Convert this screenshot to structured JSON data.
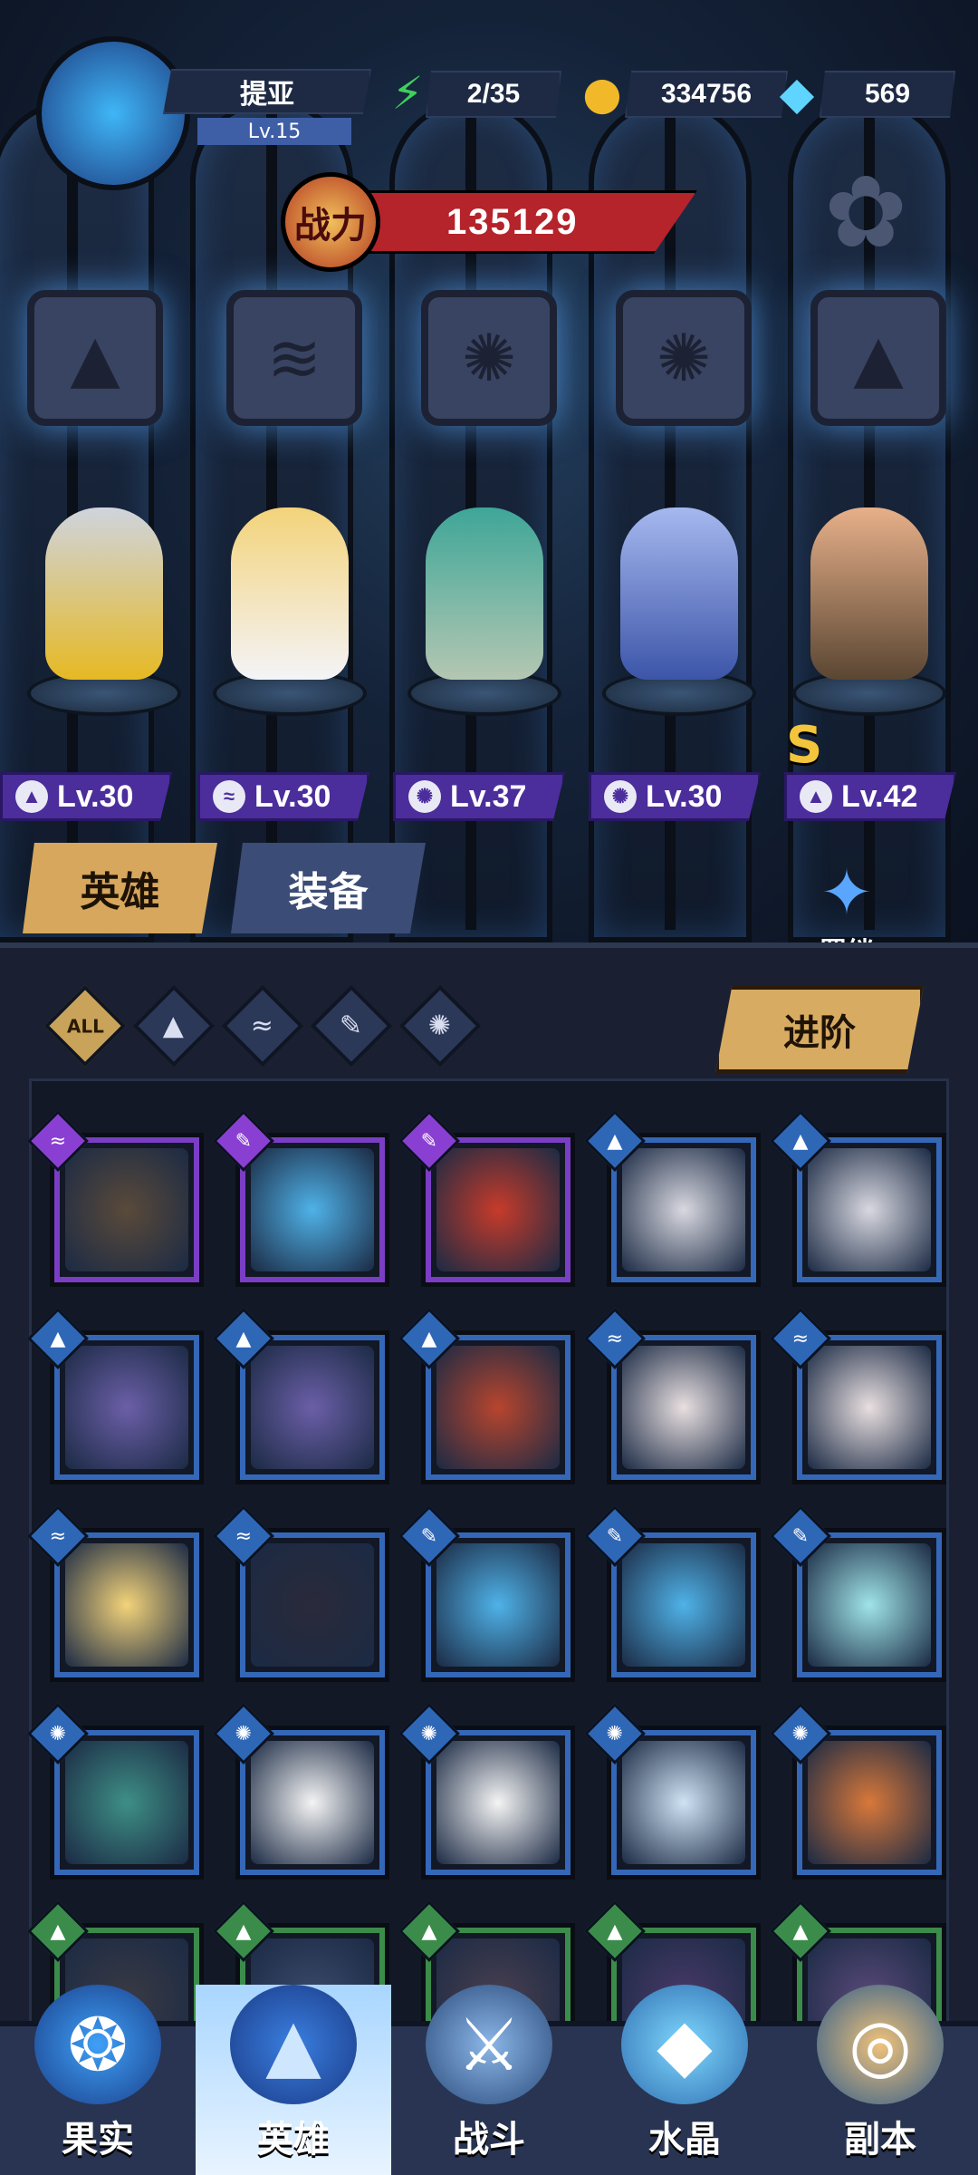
{
  "player": {
    "name": "提亚",
    "level": "Lv.15"
  },
  "resources": {
    "energy": "2/35",
    "gold": "334756",
    "gems": "569"
  },
  "power": {
    "label": "战力",
    "value": "135129"
  },
  "lineup": [
    {
      "level": "Lv.30",
      "class_icon": "warrior-icon"
    },
    {
      "level": "Lv.30",
      "class_icon": "wing-icon"
    },
    {
      "level": "Lv.37",
      "class_icon": "beast-icon"
    },
    {
      "level": "Lv.30",
      "class_icon": "beast-icon"
    },
    {
      "level": "Lv.42",
      "class_icon": "warrior-icon",
      "rank": "S"
    }
  ],
  "tabs": {
    "heroes": "英雄",
    "equipment": "装备"
  },
  "bond_label": "羁绊",
  "filters": {
    "all": "ALL"
  },
  "advance_label": "进阶",
  "nav": {
    "fruit": "果实",
    "heroes": "英雄",
    "battle": "战斗",
    "crystal": "水晶",
    "dungeon": "副本"
  }
}
